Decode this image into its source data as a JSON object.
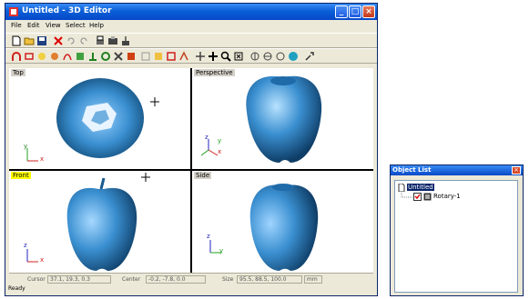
{
  "window": {
    "title": "Untitled - 3D Editor",
    "minimize": "_",
    "maximize": "□",
    "close": "×"
  },
  "menu": [
    "File",
    "Edit",
    "View",
    "Select",
    "Help"
  ],
  "viewports": {
    "top": "Top",
    "perspective": "Perspective",
    "front": "Front",
    "side": "Side"
  },
  "axes": {
    "top": {
      "v": "y",
      "h": "x"
    },
    "perspective": {
      "v": "z",
      "h": "x",
      "d": "y"
    },
    "front": {
      "v": "z",
      "h": "x"
    },
    "side": {
      "v": "z",
      "h": "y"
    }
  },
  "status": {
    "cursor_label": "Cursor",
    "cursor_value": "37.1, 19.3, 0.3",
    "center_label": "Center",
    "center_value": "-0.2, -7.8, 0.0",
    "size_label": "Size",
    "size_value": "95.5, 88.5, 100.0",
    "unit": "mm",
    "ready": "Ready"
  },
  "object_list": {
    "title": "Object List",
    "close": "×",
    "root": "Untitled",
    "child": "Rotary-1"
  },
  "colors": {
    "apple": "#3a8fd0",
    "titlebar": "#0a5fd8"
  }
}
